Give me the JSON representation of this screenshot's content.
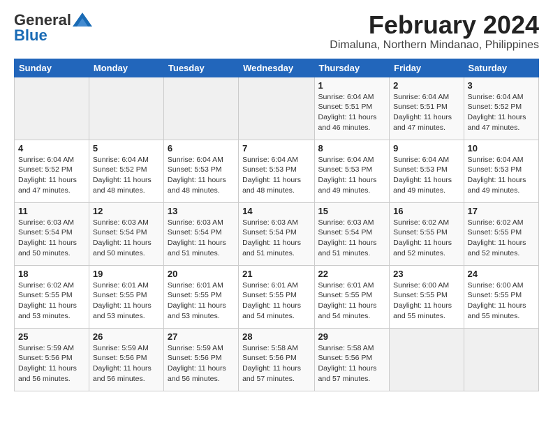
{
  "logo": {
    "general": "General",
    "blue": "Blue"
  },
  "title": "February 2024",
  "subtitle": "Dimaluna, Northern Mindanao, Philippines",
  "days_of_week": [
    "Sunday",
    "Monday",
    "Tuesday",
    "Wednesday",
    "Thursday",
    "Friday",
    "Saturday"
  ],
  "weeks": [
    [
      {
        "num": "",
        "info": ""
      },
      {
        "num": "",
        "info": ""
      },
      {
        "num": "",
        "info": ""
      },
      {
        "num": "",
        "info": ""
      },
      {
        "num": "1",
        "info": "Sunrise: 6:04 AM\nSunset: 5:51 PM\nDaylight: 11 hours\nand 46 minutes."
      },
      {
        "num": "2",
        "info": "Sunrise: 6:04 AM\nSunset: 5:51 PM\nDaylight: 11 hours\nand 47 minutes."
      },
      {
        "num": "3",
        "info": "Sunrise: 6:04 AM\nSunset: 5:52 PM\nDaylight: 11 hours\nand 47 minutes."
      }
    ],
    [
      {
        "num": "4",
        "info": "Sunrise: 6:04 AM\nSunset: 5:52 PM\nDaylight: 11 hours\nand 47 minutes."
      },
      {
        "num": "5",
        "info": "Sunrise: 6:04 AM\nSunset: 5:52 PM\nDaylight: 11 hours\nand 48 minutes."
      },
      {
        "num": "6",
        "info": "Sunrise: 6:04 AM\nSunset: 5:53 PM\nDaylight: 11 hours\nand 48 minutes."
      },
      {
        "num": "7",
        "info": "Sunrise: 6:04 AM\nSunset: 5:53 PM\nDaylight: 11 hours\nand 48 minutes."
      },
      {
        "num": "8",
        "info": "Sunrise: 6:04 AM\nSunset: 5:53 PM\nDaylight: 11 hours\nand 49 minutes."
      },
      {
        "num": "9",
        "info": "Sunrise: 6:04 AM\nSunset: 5:53 PM\nDaylight: 11 hours\nand 49 minutes."
      },
      {
        "num": "10",
        "info": "Sunrise: 6:04 AM\nSunset: 5:53 PM\nDaylight: 11 hours\nand 49 minutes."
      }
    ],
    [
      {
        "num": "11",
        "info": "Sunrise: 6:03 AM\nSunset: 5:54 PM\nDaylight: 11 hours\nand 50 minutes."
      },
      {
        "num": "12",
        "info": "Sunrise: 6:03 AM\nSunset: 5:54 PM\nDaylight: 11 hours\nand 50 minutes."
      },
      {
        "num": "13",
        "info": "Sunrise: 6:03 AM\nSunset: 5:54 PM\nDaylight: 11 hours\nand 51 minutes."
      },
      {
        "num": "14",
        "info": "Sunrise: 6:03 AM\nSunset: 5:54 PM\nDaylight: 11 hours\nand 51 minutes."
      },
      {
        "num": "15",
        "info": "Sunrise: 6:03 AM\nSunset: 5:54 PM\nDaylight: 11 hours\nand 51 minutes."
      },
      {
        "num": "16",
        "info": "Sunrise: 6:02 AM\nSunset: 5:55 PM\nDaylight: 11 hours\nand 52 minutes."
      },
      {
        "num": "17",
        "info": "Sunrise: 6:02 AM\nSunset: 5:55 PM\nDaylight: 11 hours\nand 52 minutes."
      }
    ],
    [
      {
        "num": "18",
        "info": "Sunrise: 6:02 AM\nSunset: 5:55 PM\nDaylight: 11 hours\nand 53 minutes."
      },
      {
        "num": "19",
        "info": "Sunrise: 6:01 AM\nSunset: 5:55 PM\nDaylight: 11 hours\nand 53 minutes."
      },
      {
        "num": "20",
        "info": "Sunrise: 6:01 AM\nSunset: 5:55 PM\nDaylight: 11 hours\nand 53 minutes."
      },
      {
        "num": "21",
        "info": "Sunrise: 6:01 AM\nSunset: 5:55 PM\nDaylight: 11 hours\nand 54 minutes."
      },
      {
        "num": "22",
        "info": "Sunrise: 6:01 AM\nSunset: 5:55 PM\nDaylight: 11 hours\nand 54 minutes."
      },
      {
        "num": "23",
        "info": "Sunrise: 6:00 AM\nSunset: 5:55 PM\nDaylight: 11 hours\nand 55 minutes."
      },
      {
        "num": "24",
        "info": "Sunrise: 6:00 AM\nSunset: 5:55 PM\nDaylight: 11 hours\nand 55 minutes."
      }
    ],
    [
      {
        "num": "25",
        "info": "Sunrise: 5:59 AM\nSunset: 5:56 PM\nDaylight: 11 hours\nand 56 minutes."
      },
      {
        "num": "26",
        "info": "Sunrise: 5:59 AM\nSunset: 5:56 PM\nDaylight: 11 hours\nand 56 minutes."
      },
      {
        "num": "27",
        "info": "Sunrise: 5:59 AM\nSunset: 5:56 PM\nDaylight: 11 hours\nand 56 minutes."
      },
      {
        "num": "28",
        "info": "Sunrise: 5:58 AM\nSunset: 5:56 PM\nDaylight: 11 hours\nand 57 minutes."
      },
      {
        "num": "29",
        "info": "Sunrise: 5:58 AM\nSunset: 5:56 PM\nDaylight: 11 hours\nand 57 minutes."
      },
      {
        "num": "",
        "info": ""
      },
      {
        "num": "",
        "info": ""
      }
    ]
  ]
}
